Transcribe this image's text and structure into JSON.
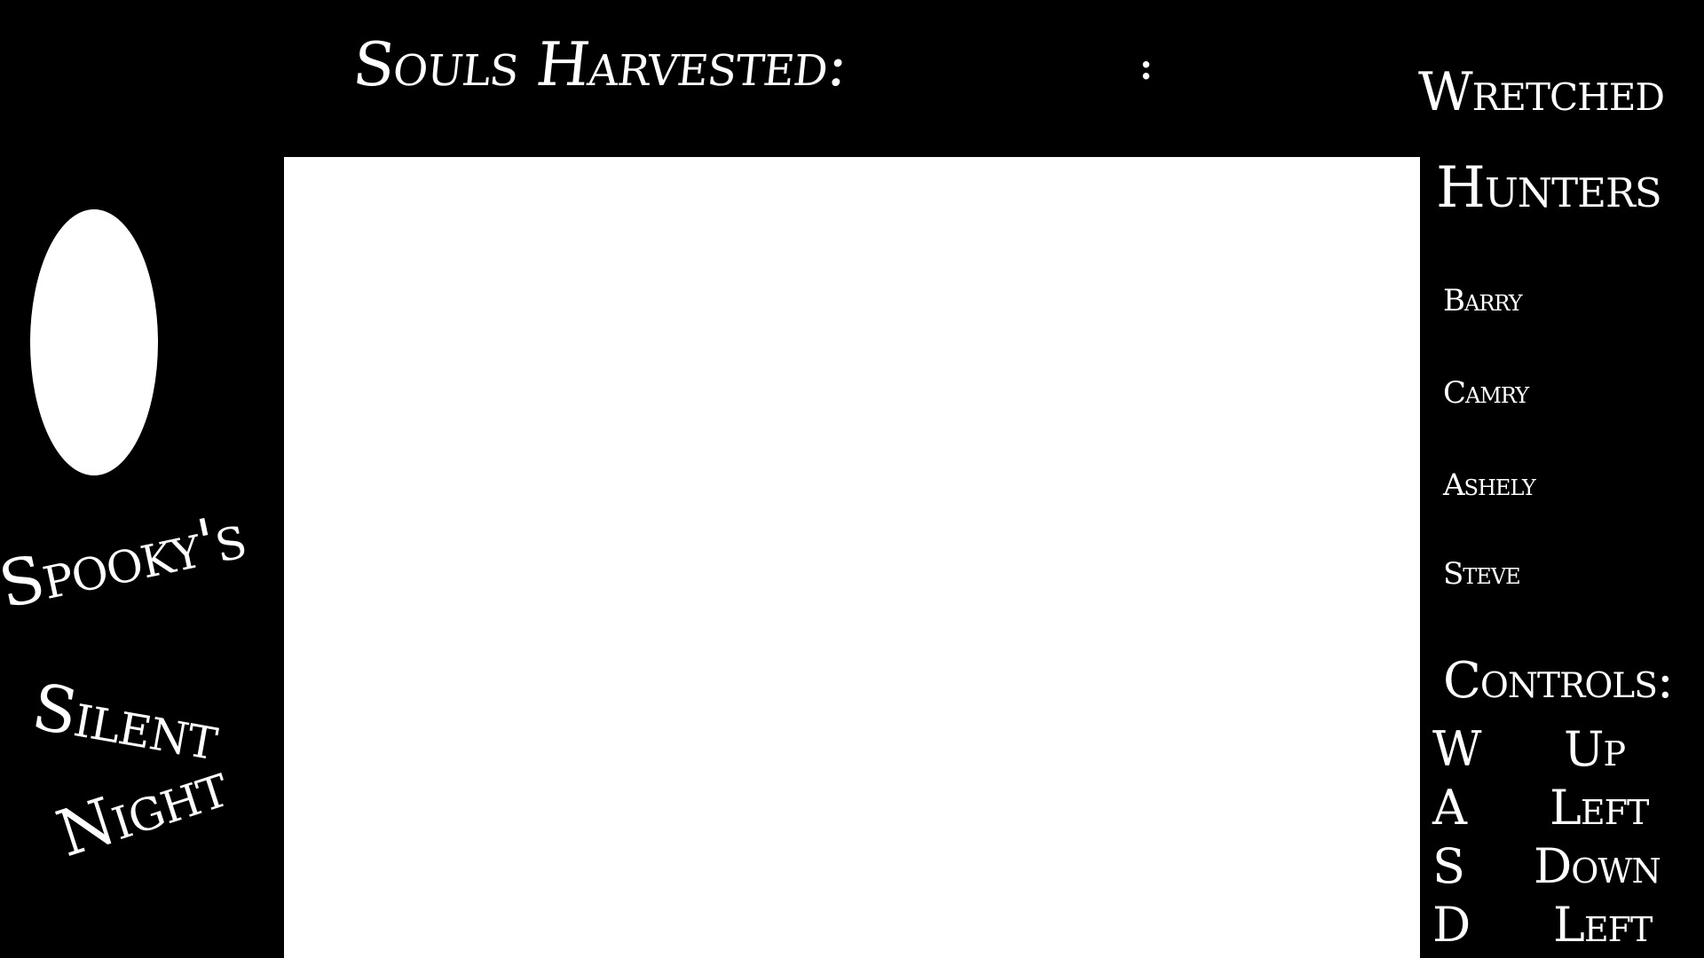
{
  "header": {
    "score_label": "Souls Harvested:",
    "score_value": ":"
  },
  "game_title": {
    "line1": "Spooky's",
    "line2": "Silent",
    "line3": "Night"
  },
  "hunters": {
    "title_line1": "Wretched",
    "title_line2": "Hunters",
    "names": [
      "Barry",
      "Camry",
      "Ashely",
      "Steve"
    ]
  },
  "controls": {
    "title": "Controls:",
    "rows": [
      {
        "key": "W",
        "action": "Up"
      },
      {
        "key": "A",
        "action": "Left"
      },
      {
        "key": "S",
        "action": "Down"
      },
      {
        "key": "D",
        "action": "Left"
      }
    ]
  },
  "colors": {
    "background": "#000000",
    "foreground": "#ffffff",
    "game_area": "#ffffff"
  }
}
